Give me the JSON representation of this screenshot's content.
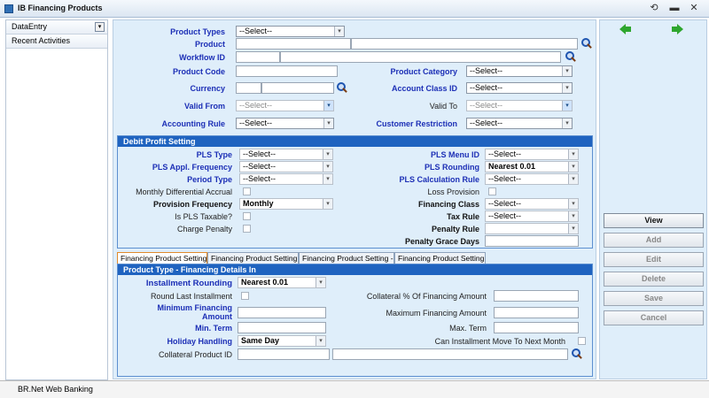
{
  "window": {
    "title": "IB Financing Products",
    "restore_glyph": "⟲",
    "minimize_glyph": "▬",
    "close_glyph": "✕"
  },
  "sidebar": {
    "items": [
      {
        "label": "DataEntry",
        "dropdown_glyph": "▾"
      },
      {
        "label": "Recent Activities"
      }
    ]
  },
  "form": {
    "product_types": {
      "label": "Product Types",
      "value": "--Select--"
    },
    "product": {
      "label": "Product"
    },
    "workflow_id": {
      "label": "Workflow ID"
    },
    "product_code": {
      "label": "Product Code"
    },
    "product_category": {
      "label": "Product Category",
      "value": "--Select--"
    },
    "currency": {
      "label": "Currency"
    },
    "account_class_id": {
      "label": "Account Class ID",
      "value": "--Select--"
    },
    "valid_from": {
      "label": "Valid From",
      "value": "--Select--"
    },
    "valid_to": {
      "label": "Valid To",
      "value": "--Select--"
    },
    "accounting_rule": {
      "label": "Accounting Rule",
      "value": "--Select--"
    },
    "customer_restriction": {
      "label": "Customer Restriction",
      "value": "--Select--"
    }
  },
  "debit_profit": {
    "title": "Debit Profit Setting",
    "pls_type": {
      "label": "PLS Type",
      "value": "--Select--"
    },
    "pls_menu_id": {
      "label": "PLS Menu ID",
      "value": "--Select--"
    },
    "pls_appl_frequency": {
      "label": "PLS Appl. Frequency",
      "value": "--Select--"
    },
    "pls_rounding": {
      "label": "PLS Rounding",
      "value": "Nearest 0.01"
    },
    "period_type": {
      "label": "Period Type",
      "value": "--Select--"
    },
    "pls_calculation_rule": {
      "label": "PLS Calculation Rule",
      "value": "--Select--"
    },
    "monthly_differential_accrual": {
      "label": "Monthly Differential Accrual"
    },
    "loss_provision": {
      "label": "Loss Provision"
    },
    "provision_frequency": {
      "label": "Provision Frequency",
      "value": "Monthly"
    },
    "financing_class": {
      "label": "Financing Class",
      "value": "--Select--"
    },
    "is_pls_taxable": {
      "label": "Is PLS Taxable?"
    },
    "tax_rule": {
      "label": "Tax Rule",
      "value": "--Select--"
    },
    "charge_penalty": {
      "label": "Charge Penalty"
    },
    "penalty_rule": {
      "label": "Penalty Rule",
      "value": ""
    },
    "penalty_grace_days": {
      "label": "Penalty Grace Days"
    }
  },
  "tabs": [
    {
      "label": "Financing Product Setting -I"
    },
    {
      "label": "Financing Product Setting -II"
    },
    {
      "label": "Financing Product Setting -III"
    },
    {
      "label": "Financing Product Setting -IV"
    }
  ],
  "details": {
    "title": "Product Type - Financing Details In",
    "installment_rounding": {
      "label": "Installment Rounding",
      "value": "Nearest 0.01"
    },
    "round_last_installment": {
      "label": "Round Last Installment"
    },
    "collateral_pct": {
      "label": "Collateral % Of Financing Amount"
    },
    "min_financing_amount": {
      "label": "Minimum Financing Amount"
    },
    "max_financing_amount": {
      "label": "Maximum Financing Amount"
    },
    "min_term": {
      "label": "Min. Term"
    },
    "max_term": {
      "label": "Max. Term"
    },
    "holiday_handling": {
      "label": "Holiday Handling",
      "value": "Same Day"
    },
    "can_installment_move": {
      "label": "Can Installment Move To Next Month"
    },
    "collateral_product_id": {
      "label": "Collateral Product ID"
    }
  },
  "actions": {
    "view": "View",
    "add": "Add",
    "edit": "Edit",
    "delete": "Delete",
    "save": "Save",
    "cancel": "Cancel"
  },
  "status": {
    "text": "BR.Net Web Banking"
  },
  "icons": {
    "select_arrow": "▾",
    "accent": "#1f63c0",
    "label_blue": "#1c2fb6",
    "nav_green": "#2ea62e"
  }
}
